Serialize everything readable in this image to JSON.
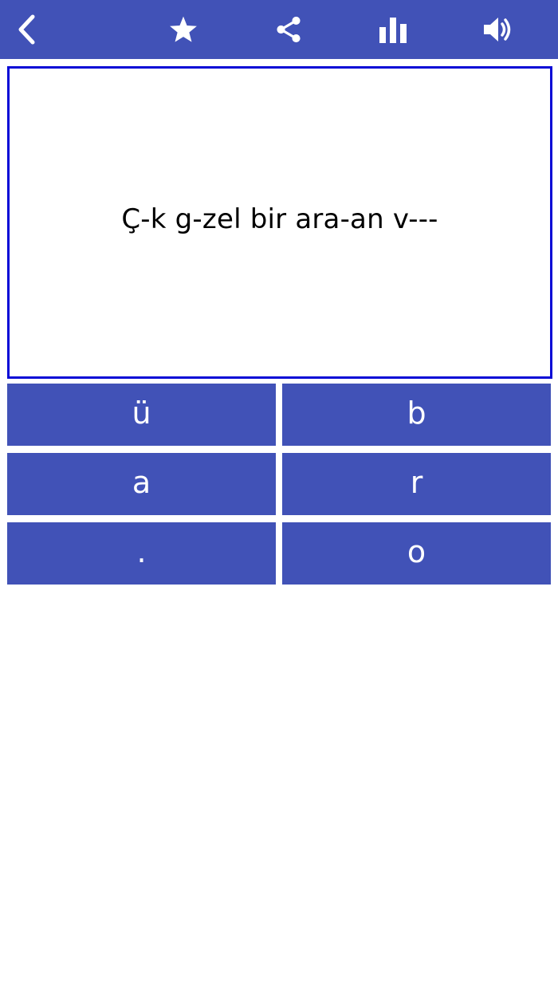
{
  "colors": {
    "toolbar_bg": "#4152b7",
    "button_bg": "#4152b7",
    "prompt_border": "#0a0ad6",
    "text": "#000000",
    "button_text": "#ffffff"
  },
  "toolbar": {
    "icons": [
      "chevron-left-icon",
      "star-icon",
      "share-icon",
      "bar-chart-icon",
      "speaker-icon"
    ]
  },
  "prompt": {
    "text": "Ç-k g-zel bir ara-an v---"
  },
  "answers": [
    {
      "label": "ü"
    },
    {
      "label": "b"
    },
    {
      "label": "a"
    },
    {
      "label": "r"
    },
    {
      "label": "."
    },
    {
      "label": "o"
    }
  ]
}
